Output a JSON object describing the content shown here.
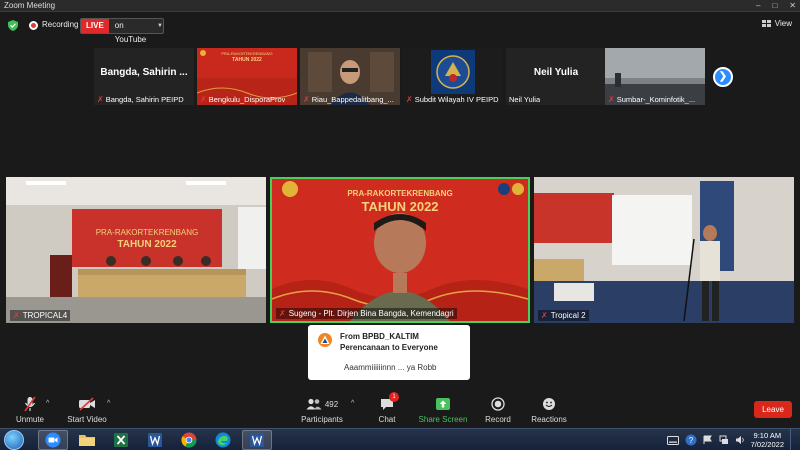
{
  "window": {
    "title": "Zoom Meeting",
    "controls": [
      "minimize-icon",
      "maximize-icon",
      "close-icon"
    ]
  },
  "status": {
    "recording_label": "Recording",
    "live_badge": "LIVE",
    "live_target": "on YouTube",
    "view_label": "View"
  },
  "thumbnails": [
    {
      "display_name": "Bangda, Sahirin ...",
      "label": "Bangda, Sahirin PEIPD",
      "muted": true
    },
    {
      "label": "Bengkulu_DisporaProv",
      "muted": true
    },
    {
      "label": "Riau_Bappedalitbang_...",
      "muted": true
    },
    {
      "label": "Subdit Wilayah IV PEIPD",
      "muted": true
    },
    {
      "display_name": "Neil Yulia",
      "label": "Neil Yulia",
      "muted": false
    },
    {
      "label": "Sumbar-_Kominfotik_...",
      "muted": true
    }
  ],
  "banner": {
    "line1": "PRA-RAKORTEKRENBANG",
    "line2": "TAHUN 2022"
  },
  "tiles": [
    {
      "label": "TROPICAL4",
      "muted": true
    },
    {
      "label": "Sugeng - Plt. Dirjen Bina Bangda, Kemendagri",
      "muted": true,
      "active_speaker": true
    },
    {
      "label": "Tropical 2",
      "muted": true
    }
  ],
  "chat_popup": {
    "from_line1": "From BPBD_KALTIM",
    "from_line2": "Perencanaan to Everyone",
    "message": "Aaammiiiiiinnn ... ya Robb"
  },
  "toolbar": {
    "unmute": "Unmute",
    "start_video": "Start Video",
    "participants": "Participants",
    "participants_count": "492",
    "chat": "Chat",
    "chat_badge": "1",
    "share_screen": "Share Screen",
    "record": "Record",
    "reactions": "Reactions",
    "leave": "Leave",
    "share_color": "#49c15e",
    "leave_color": "#d9271b"
  },
  "taskbar": {
    "apps": [
      "zoom-icon",
      "file-explorer-icon",
      "excel-icon",
      "word-icon",
      "chrome-icon",
      "edge-icon",
      "word-icon"
    ],
    "time": "9:10 AM",
    "date": "7/02/2022"
  }
}
